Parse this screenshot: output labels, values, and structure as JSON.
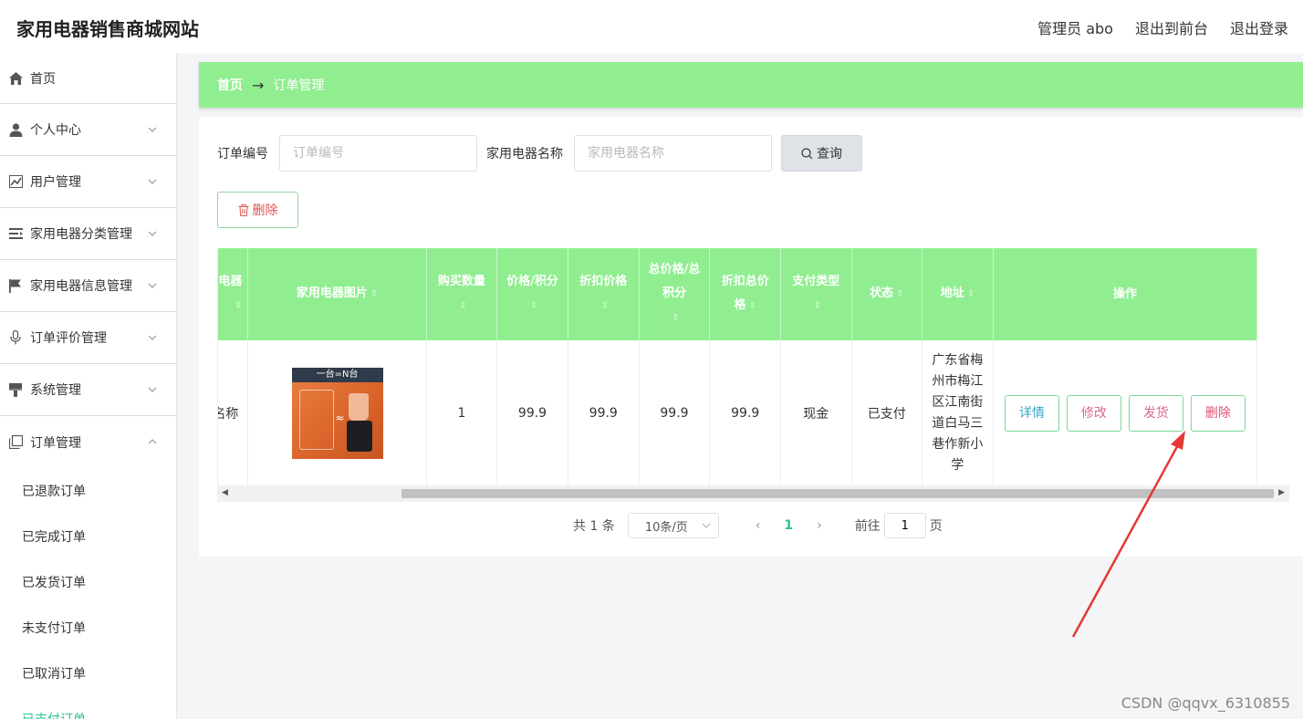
{
  "app": {
    "title": "家用电器销售商城网站"
  },
  "top_links": {
    "admin": "管理员 abo",
    "to_front": "退出到前台",
    "logout": "退出登录"
  },
  "sidebar": {
    "items": [
      {
        "label": "首页"
      },
      {
        "label": "个人中心"
      },
      {
        "label": "用户管理"
      },
      {
        "label": "家用电器分类管理"
      },
      {
        "label": "家用电器信息管理"
      },
      {
        "label": "订单评价管理"
      },
      {
        "label": "系统管理"
      },
      {
        "label": "订单管理"
      }
    ],
    "sub_items": [
      {
        "label": "已退款订单"
      },
      {
        "label": "已完成订单"
      },
      {
        "label": "已发货订单"
      },
      {
        "label": "未支付订单"
      },
      {
        "label": "已取消订单"
      },
      {
        "label": "已支付订单"
      }
    ]
  },
  "breadcrumb": {
    "home": "首页",
    "arrow": "→",
    "current": "订单管理"
  },
  "search": {
    "order_no_label": "订单编号",
    "order_no_placeholder": "订单编号",
    "name_label": "家用电器名称",
    "name_placeholder": "家用电器名称",
    "query_button": "查询"
  },
  "delete_button": "删除",
  "table": {
    "headers": {
      "name_partial": "电器",
      "image": "家用电器图片",
      "qty": "购买数量",
      "price": "价格/积分",
      "discount_price": "折扣价格",
      "total": "总价格/总积分",
      "discount_total": "折扣总价格",
      "pay_type": "支付类型",
      "status": "状态",
      "address": "地址",
      "ops": "操作"
    },
    "rows": [
      {
        "name_partial": "名称",
        "qty": "1",
        "price": "99.9",
        "discount_price": "99.9",
        "total": "99.9",
        "discount_total": "99.9",
        "pay_type": "现金",
        "status": "已支付",
        "address": "广东省梅州市梅江区江南街道白马三巷作新小学",
        "image_text": "一台=N台"
      }
    ],
    "ops": {
      "detail": "详情",
      "edit": "修改",
      "ship": "发货",
      "delete": "删除"
    }
  },
  "pagination": {
    "total": "共 1 条",
    "page_size": "10条/页",
    "current_page": "1",
    "goto_label": "前往",
    "goto_value": "1",
    "page_suffix": "页"
  },
  "watermark": "CSDN @qqvx_6310855",
  "colors": {
    "accent": "#90ee90",
    "active": "#2ec48c",
    "annotation": "#e53935"
  }
}
